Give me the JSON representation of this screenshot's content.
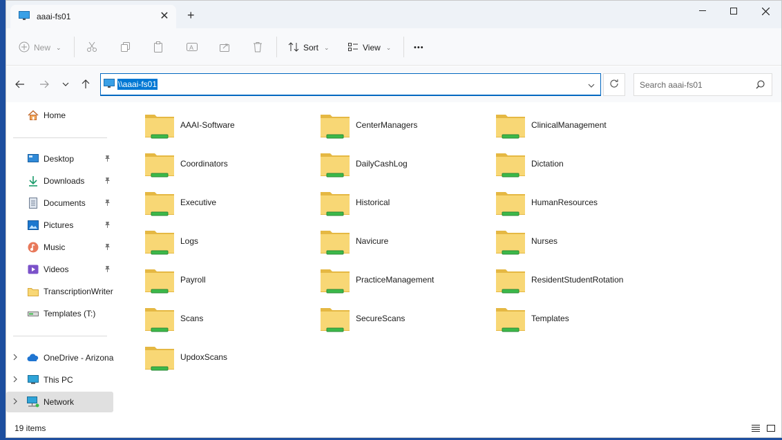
{
  "window": {
    "tab_title": "aaai-fs01"
  },
  "toolbar": {
    "new_label": "New",
    "sort_label": "Sort",
    "view_label": "View",
    "more_label": "•••"
  },
  "address": {
    "path": "\\\\aaai-fs01"
  },
  "search": {
    "placeholder": "Search aaai-fs01"
  },
  "sidebar": {
    "home": "Home",
    "quick_access": [
      {
        "label": "Desktop",
        "icon": "desktop-icon",
        "pinned": true
      },
      {
        "label": "Downloads",
        "icon": "download-icon",
        "pinned": true
      },
      {
        "label": "Documents",
        "icon": "documents-icon",
        "pinned": true
      },
      {
        "label": "Pictures",
        "icon": "pictures-icon",
        "pinned": true
      },
      {
        "label": "Music",
        "icon": "music-icon",
        "pinned": true
      },
      {
        "label": "Videos",
        "icon": "videos-icon",
        "pinned": true
      },
      {
        "label": "TranscriptionWriter",
        "icon": "folder-icon",
        "pinned": false
      },
      {
        "label": "Templates (T:)",
        "icon": "drive-icon",
        "pinned": false
      }
    ],
    "locations": [
      {
        "label": "OneDrive - Arizona",
        "icon": "onedrive-icon",
        "selected": false
      },
      {
        "label": "This PC",
        "icon": "pc-icon",
        "selected": false
      },
      {
        "label": "Network",
        "icon": "network-icon",
        "selected": true
      }
    ]
  },
  "folders": [
    "AAAI-Software",
    "CenterManagers",
    "ClinicalManagement",
    "Coordinators",
    "DailyCashLog",
    "Dictation",
    "Executive",
    "Historical",
    "HumanResources",
    "Logs",
    "Navicure",
    "Nurses",
    "Payroll",
    "PracticeManagement",
    "ResidentStudentRotation",
    "Scans",
    "SecureScans",
    "Templates",
    "UpdoxScans"
  ],
  "status": {
    "item_count": "19 items"
  },
  "colors": {
    "accent": "#0078d4",
    "folder": "#f8d775",
    "share_bar": "#3cb94a"
  }
}
